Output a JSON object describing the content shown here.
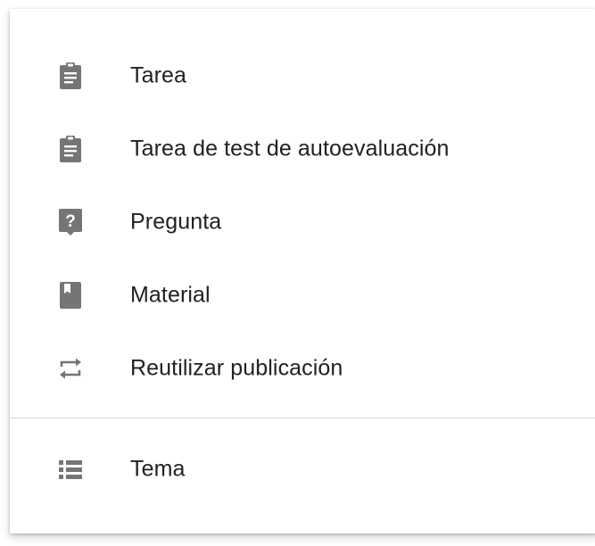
{
  "menu": {
    "items": [
      {
        "label": "Tarea",
        "icon": "assignment-icon"
      },
      {
        "label": "Tarea de test de autoevaluación",
        "icon": "assignment-icon"
      },
      {
        "label": "Pregunta",
        "icon": "question-icon"
      },
      {
        "label": "Material",
        "icon": "book-icon"
      },
      {
        "label": "Reutilizar publicación",
        "icon": "repeat-icon"
      }
    ],
    "topic": {
      "label": "Tema",
      "icon": "topic-list-icon"
    }
  },
  "colors": {
    "icon": "#757575",
    "text": "#212121",
    "divider": "#dadada"
  }
}
